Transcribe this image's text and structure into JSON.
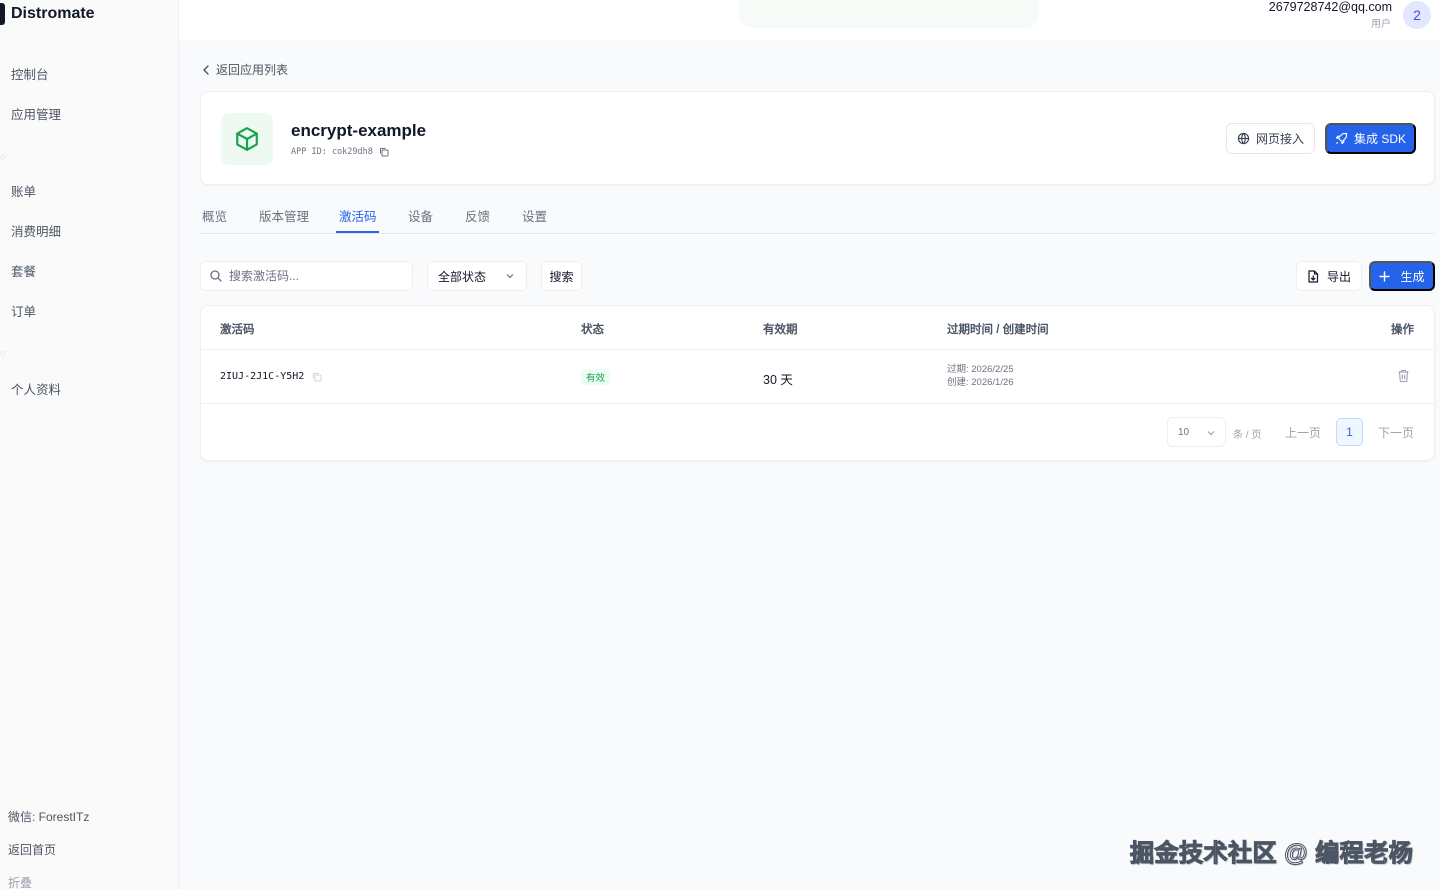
{
  "sidebar": {
    "brand": "Distromate",
    "items": [
      {
        "label": "控制台"
      },
      {
        "label": "应用管理"
      },
      {
        "label": "账单"
      },
      {
        "label": "消费明细"
      },
      {
        "label": "套餐"
      },
      {
        "label": "订单"
      },
      {
        "label": "个人资料"
      }
    ],
    "footer": {
      "wechat": "微信: ForestITz",
      "home": "返回首页",
      "collapse": "折叠"
    }
  },
  "topbar": {
    "email": "2679728742@qq.com",
    "role": "用户",
    "avatar": "2"
  },
  "back_link": "返回应用列表",
  "app": {
    "name": "encrypt-example",
    "id_label": "APP ID: cok29dh8",
    "web_button": "网页接入",
    "sdk_button": "集成 SDK",
    "accent": "#2563eb",
    "icon": "package-icon"
  },
  "tabs": [
    {
      "label": "概览"
    },
    {
      "label": "版本管理"
    },
    {
      "label": "激活码",
      "active": true
    },
    {
      "label": "设备"
    },
    {
      "label": "反馈"
    },
    {
      "label": "设置"
    }
  ],
  "toolbar": {
    "search_placeholder": "搜索激活码...",
    "status_filter": "全部状态",
    "search_button": "搜索",
    "export_button": "导出",
    "generate_button": "生成"
  },
  "table": {
    "headers": [
      "激活码",
      "状态",
      "有效期",
      "过期时间 / 创建时间",
      "操作"
    ],
    "rows": [
      {
        "code": "2IUJ-2J1C-Y5H2",
        "status": "有效",
        "validity": "30 天",
        "expires": "过期: 2026/2/25",
        "created": "创建: 2026/1/26"
      }
    ]
  },
  "pagination": {
    "page_size": "10",
    "per_page_label": "条 / 页",
    "prev": "上一页",
    "current": "1",
    "next": "下一页"
  },
  "watermark": "掘金技术社区 @ 编程老杨"
}
